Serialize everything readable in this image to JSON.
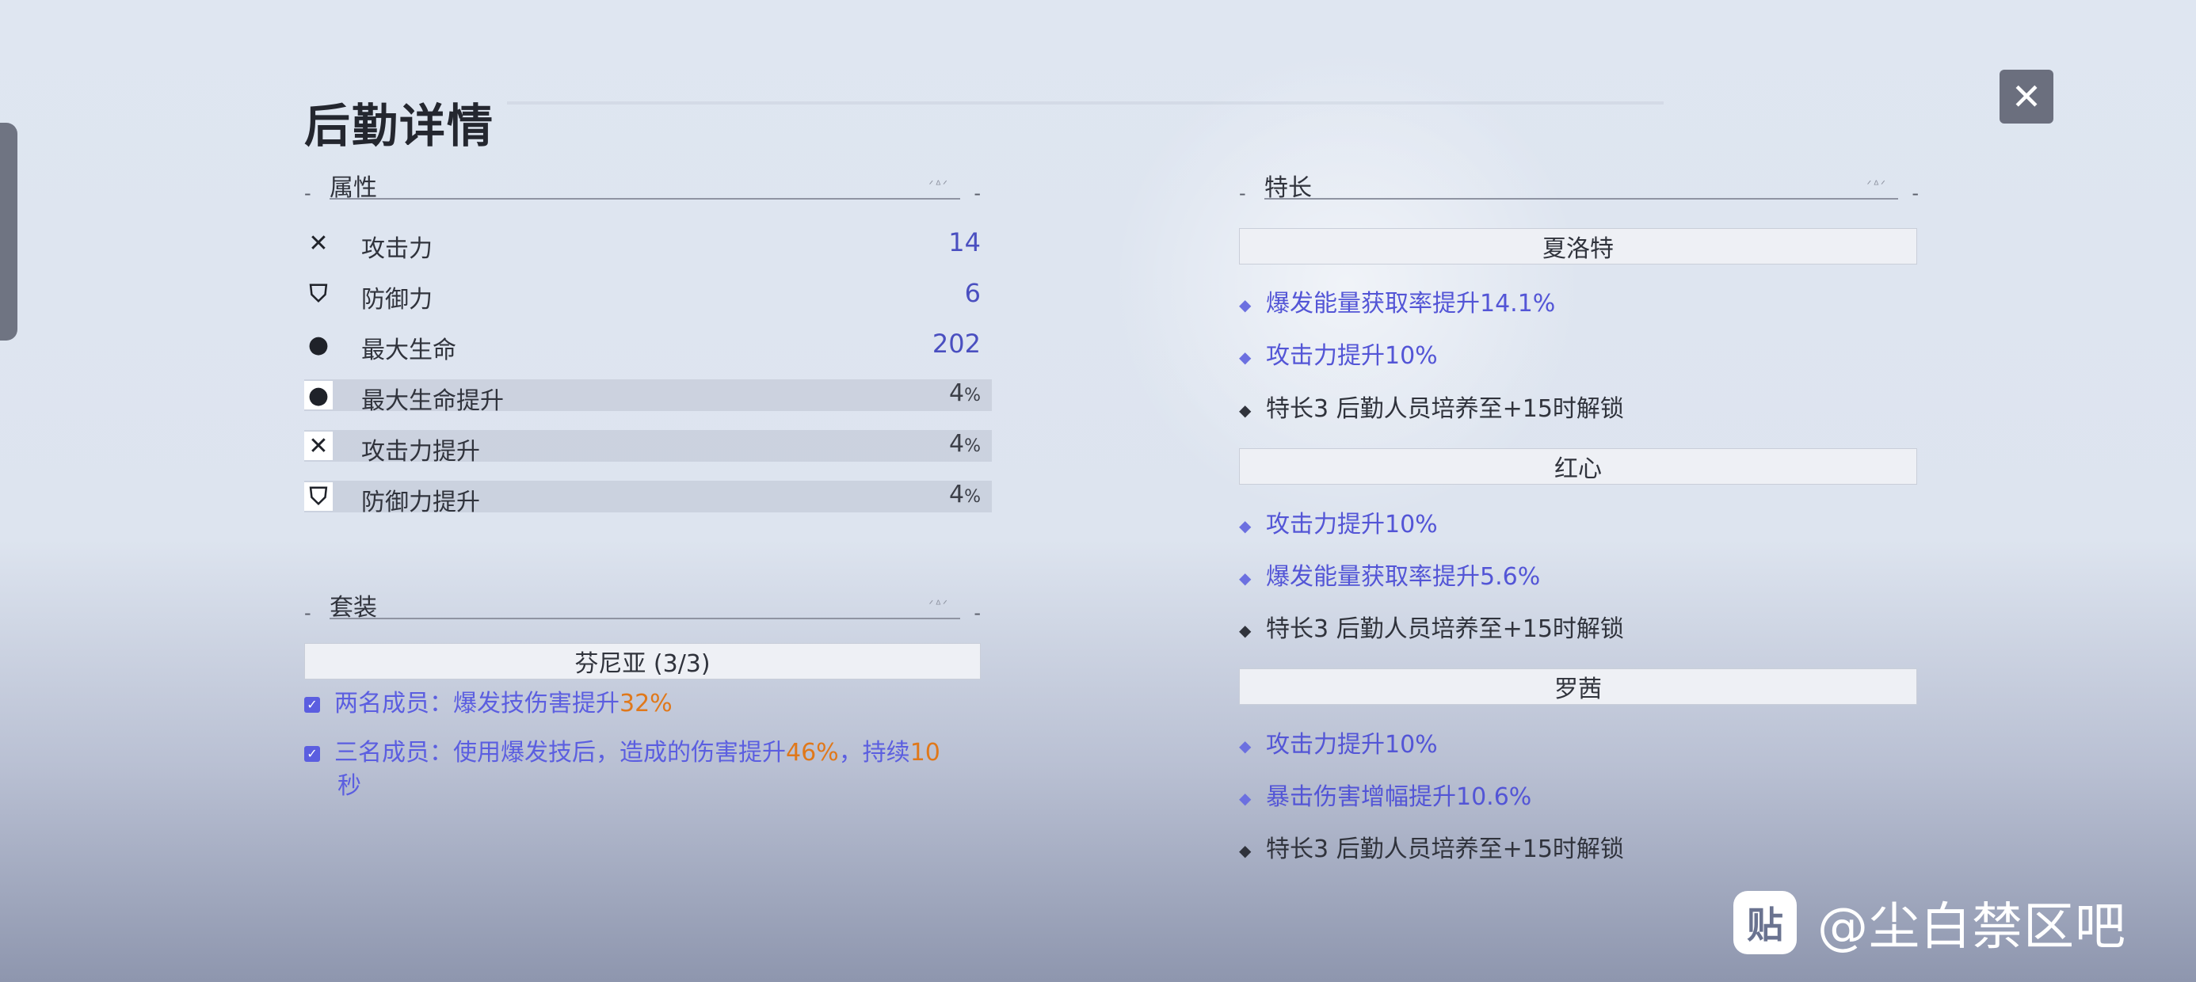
{
  "window": {
    "title": "后勤详情",
    "close_label": "✕"
  },
  "attributes": {
    "header": "属性",
    "stats": [
      {
        "icon": "swords-icon",
        "glyph": "✕",
        "name": "攻击力",
        "value": "14",
        "highlight": false
      },
      {
        "icon": "shield-icon",
        "glyph": "⛉",
        "name": "防御力",
        "value": "6",
        "highlight": false
      },
      {
        "icon": "droplet-icon",
        "glyph": "●",
        "name": "最大生命",
        "value": "202",
        "highlight": false
      },
      {
        "icon": "droplet-icon",
        "glyph": "●",
        "name": "最大生命提升",
        "value": "4",
        "unit": "%",
        "highlight": true
      },
      {
        "icon": "swords-icon",
        "glyph": "✕",
        "name": "攻击力提升",
        "value": "4",
        "unit": "%",
        "highlight": true
      },
      {
        "icon": "shield-icon",
        "glyph": "⛉",
        "name": "防御力提升",
        "value": "4",
        "unit": "%",
        "highlight": true
      }
    ]
  },
  "set": {
    "header": "套装",
    "name": "芬尼亚 (3/3)",
    "bonuses": [
      {
        "prefix": "两名成员：爆发技伤害提升",
        "hl1": "32%",
        "mid": "",
        "hl2": "",
        "cont": ""
      },
      {
        "prefix": "三名成员：使用爆发技后，造成的伤害提升",
        "hl1": "46%",
        "mid": "，持续",
        "hl2": "10",
        "cont": "秒"
      }
    ]
  },
  "specialty": {
    "header": "特长",
    "groups": [
      {
        "name": "夏洛特",
        "items": [
          {
            "text": "爆发能量获取率提升14.1%",
            "active": true
          },
          {
            "text": "攻击力提升10%",
            "active": true
          },
          {
            "text": "特长3  后勤人员培养至+15时解锁",
            "active": false
          }
        ]
      },
      {
        "name": "红心",
        "items": [
          {
            "text": "攻击力提升10%",
            "active": true
          },
          {
            "text": "爆发能量获取率提升5.6%",
            "active": true
          },
          {
            "text": "特长3  后勤人员培养至+15时解锁",
            "active": false
          }
        ]
      },
      {
        "name": "罗茜",
        "items": [
          {
            "text": "攻击力提升10%",
            "active": true
          },
          {
            "text": "暴击伤害增幅提升10.6%",
            "active": true
          },
          {
            "text": "特长3  后勤人员培养至+15时解锁",
            "active": false
          }
        ]
      }
    ]
  },
  "watermark": {
    "logo": "贴",
    "text": "@尘白禁区吧"
  },
  "colors": {
    "active_text": "#5355d6",
    "highlight_orange": "#e0781a",
    "close_bg": "#6b6f7e"
  }
}
